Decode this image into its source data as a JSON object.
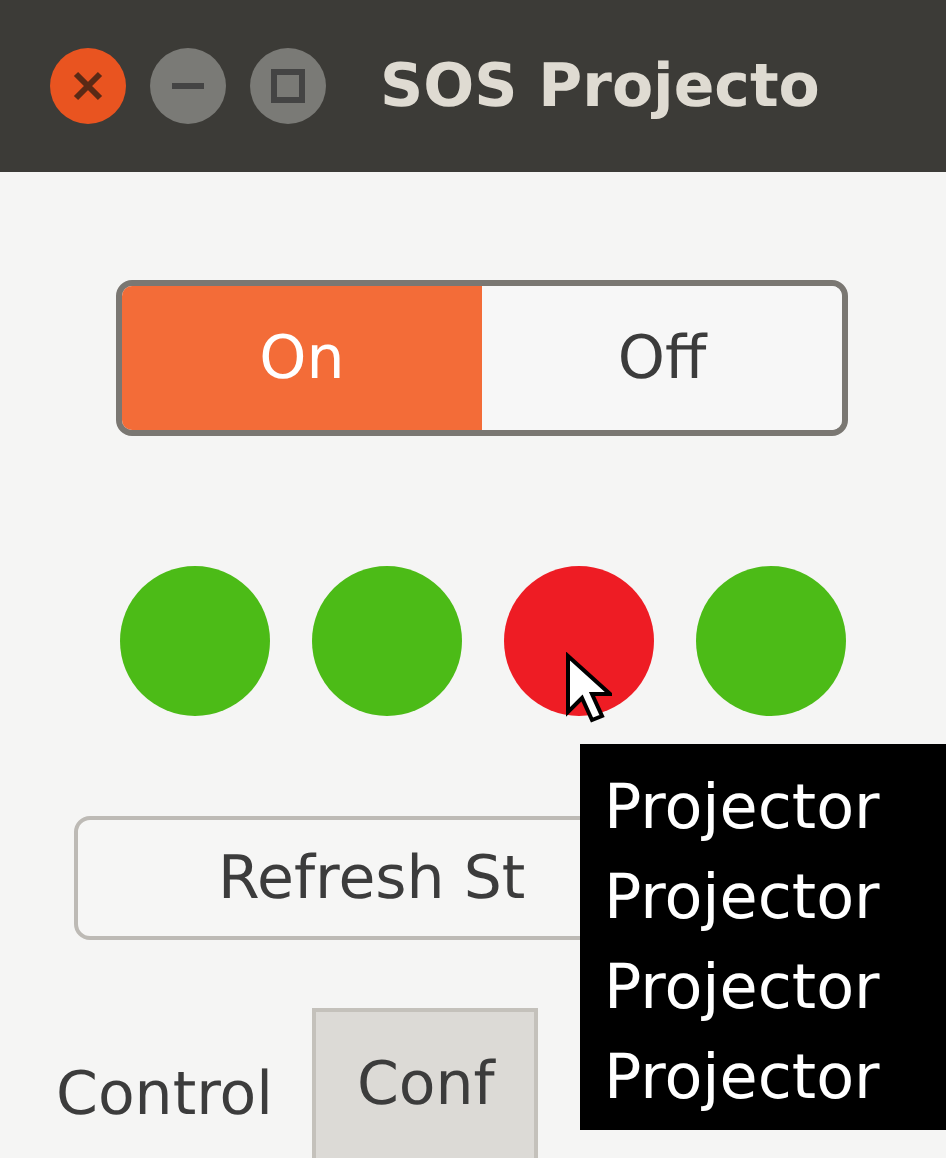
{
  "window": {
    "title": "SOS Projecto"
  },
  "power_toggle": [
    {
      "label": "On",
      "selected": true
    },
    {
      "label": "Off",
      "selected": false
    }
  ],
  "status_dots": [
    {
      "color": "#4cbb17"
    },
    {
      "color": "#4cbb17"
    },
    {
      "color": "#ee1c24"
    },
    {
      "color": "#4cbb17"
    }
  ],
  "refresh_button": {
    "label": "Refresh St"
  },
  "tabs": [
    {
      "label": "Control",
      "selected": true
    },
    {
      "label": "Conf",
      "selected": false
    }
  ],
  "tooltip": {
    "lines": [
      "Projector",
      "Projector",
      "Projector",
      "Projector"
    ]
  }
}
